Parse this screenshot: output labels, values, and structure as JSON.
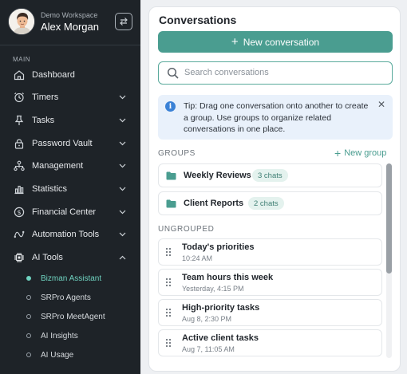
{
  "profile": {
    "workspace": "Demo Workspace",
    "name": "Alex Morgan"
  },
  "sidebar": {
    "section_label": "MAIN",
    "items": [
      {
        "label": "Dashboard",
        "icon": "home-icon",
        "expandable": false
      },
      {
        "label": "Timers",
        "icon": "timer-icon",
        "expandable": true
      },
      {
        "label": "Tasks",
        "icon": "pin-icon",
        "expandable": true
      },
      {
        "label": "Password Vault",
        "icon": "lock-icon",
        "expandable": true
      },
      {
        "label": "Management",
        "icon": "org-chart-icon",
        "expandable": true
      },
      {
        "label": "Statistics",
        "icon": "bar-chart-icon",
        "expandable": true
      },
      {
        "label": "Financial Center",
        "icon": "dollar-circle-icon",
        "expandable": true
      },
      {
        "label": "Automation Tools",
        "icon": "workflow-icon",
        "expandable": true
      },
      {
        "label": "AI Tools",
        "icon": "chip-icon",
        "expandable": true,
        "expanded": true
      }
    ],
    "ai_subitems": [
      {
        "label": "Bizman Assistant",
        "active": true
      },
      {
        "label": "SRPro Agents",
        "active": false
      },
      {
        "label": "SRPro MeetAgent",
        "active": false
      },
      {
        "label": "AI Insights",
        "active": false
      },
      {
        "label": "AI Usage",
        "active": false
      }
    ],
    "colors": {
      "background": "#1e2328",
      "active_accent": "#6fd3c0"
    }
  },
  "main": {
    "title": "Conversations",
    "new_conversation_label": "New conversation",
    "search": {
      "placeholder": "Search conversations",
      "value": ""
    },
    "tip": {
      "text": "Tip: Drag one conversation onto another to create a group. Use groups to organize related conversations in one place."
    },
    "groups_label": "GROUPS",
    "new_group_label": "New group",
    "groups": [
      {
        "name": "Weekly Reviews",
        "count": "3 chats"
      },
      {
        "name": "Client Reports",
        "count": "2 chats"
      }
    ],
    "ungrouped_label": "UNGROUPED",
    "conversations": [
      {
        "title": "Today's priorities",
        "date": "10:24 AM"
      },
      {
        "title": "Team hours this week",
        "date": "Yesterday, 4:15 PM"
      },
      {
        "title": "High-priority tasks",
        "date": "Aug 8, 2:30 PM"
      },
      {
        "title": "Active client tasks",
        "date": "Aug 7, 11:05 AM"
      }
    ],
    "colors": {
      "accent": "#4a9d90",
      "tip_background": "#e9f1fb",
      "info_icon": "#3b82d6"
    }
  }
}
